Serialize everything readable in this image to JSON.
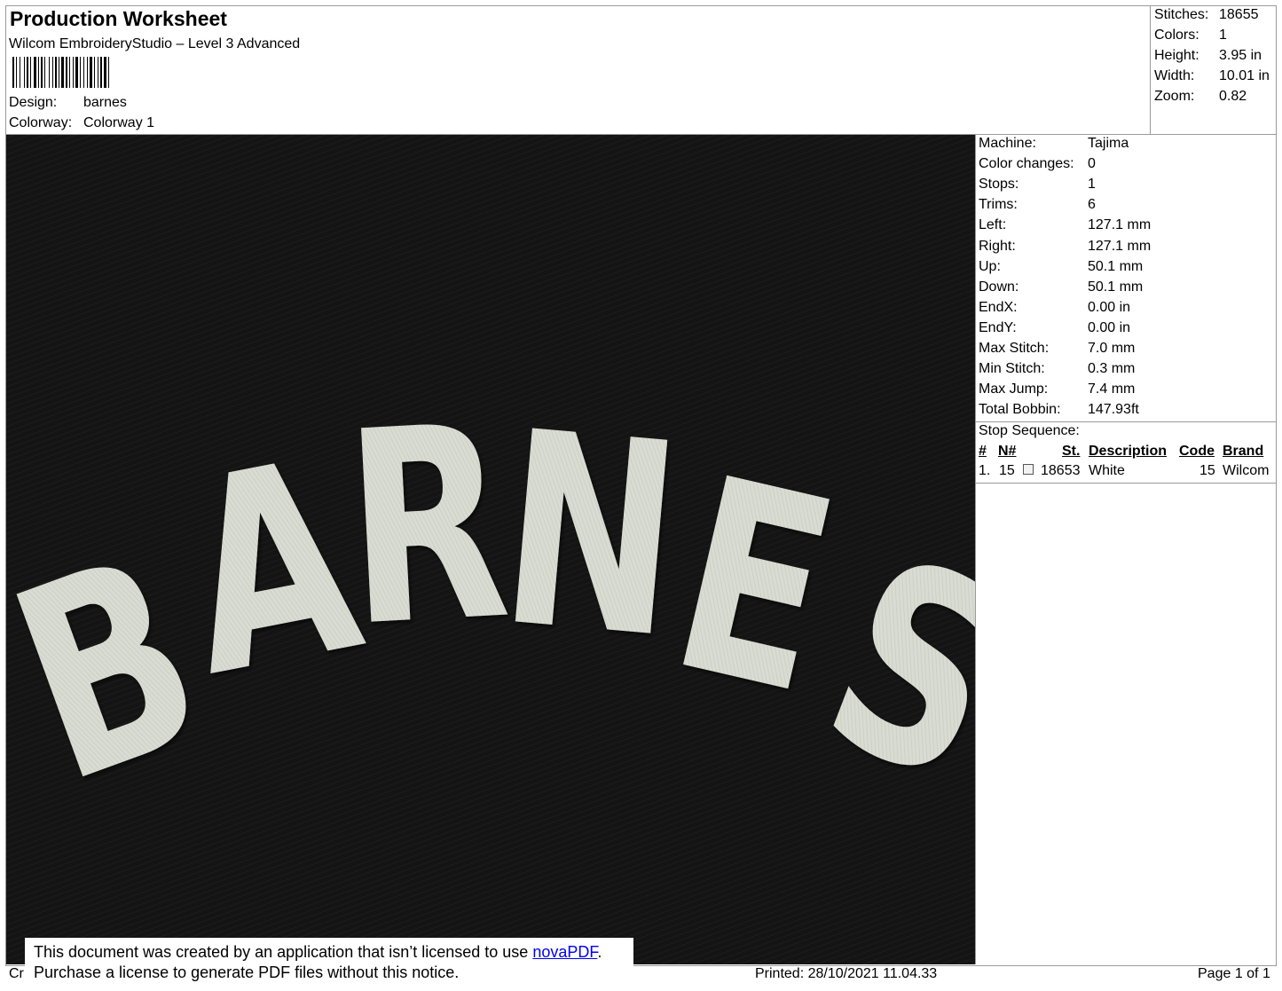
{
  "header": {
    "title": "Production Worksheet",
    "subtitle": "Wilcom EmbroideryStudio – Level 3 Advanced",
    "design_label": "Design:",
    "design_value": "barnes",
    "colorway_label": "Colorway:",
    "colorway_value": "Colorway 1"
  },
  "stats": [
    {
      "label": "Stitches:",
      "value": "18655"
    },
    {
      "label": "Colors:",
      "value": "1"
    },
    {
      "label": "Height:",
      "value": "3.95 in"
    },
    {
      "label": "Width:",
      "value": "10.01 in"
    },
    {
      "label": "Zoom:",
      "value": "0.82"
    }
  ],
  "design_preview": {
    "text": "BARNES",
    "background_color": "#141414",
    "thread_color": "#d9dcd2"
  },
  "machine_info": [
    {
      "label": "Machine:",
      "value": "Tajima"
    },
    {
      "label": "Color changes:",
      "value": "0"
    },
    {
      "label": "Stops:",
      "value": "1"
    },
    {
      "label": "Trims:",
      "value": "6"
    },
    {
      "label": "Left:",
      "value": "127.1 mm"
    },
    {
      "label": "Right:",
      "value": "127.1 mm"
    },
    {
      "label": "Up:",
      "value": "50.1 mm"
    },
    {
      "label": "Down:",
      "value": "50.1 mm"
    },
    {
      "label": "EndX:",
      "value": "0.00 in"
    },
    {
      "label": "EndY:",
      "value": "0.00 in"
    },
    {
      "label": "Max Stitch:",
      "value": "7.0 mm"
    },
    {
      "label": "Min Stitch:",
      "value": "0.3 mm"
    },
    {
      "label": "Max Jump:",
      "value": "7.4 mm"
    },
    {
      "label": "Total Bobbin:",
      "value": "147.93ft"
    }
  ],
  "stop_sequence": {
    "title": "Stop Sequence:",
    "headers": {
      "num": "#",
      "n_num": "N#",
      "stitches": "St.",
      "description": "Description",
      "code": "Code",
      "brand": "Brand"
    },
    "rows": [
      {
        "num": "1.",
        "n_num": "15",
        "stitches": "18653",
        "description": "White",
        "code": "15",
        "brand": "Wilcom",
        "color": "#f2f2f2"
      }
    ]
  },
  "footer": {
    "left": "Cr",
    "printed": "Printed: 28/10/2021 11.04.33",
    "page": "Page 1 of 1"
  },
  "notice": {
    "line1_prefix": "This document was created by an application that isn’t licensed to use ",
    "link": "novaPDF",
    "line1_suffix": ".",
    "line2": "Purchase a license to generate PDF files without this notice."
  }
}
